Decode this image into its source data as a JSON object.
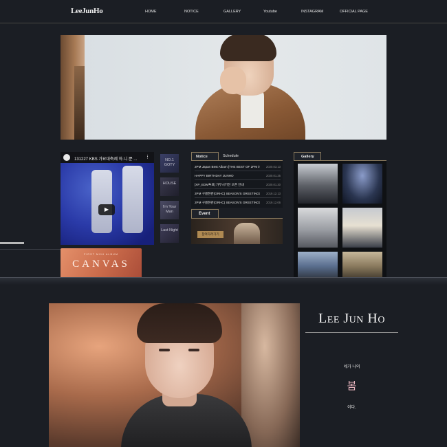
{
  "header": {
    "logo": "LeeJunHo",
    "nav": [
      "HOME",
      "NOTICE",
      "GALLERY",
      "Youtube",
      "INSTAGRAM",
      "OFFICIAL PAGE"
    ]
  },
  "video": {
    "title": "131227 KBS 가요대축제 하.니.뿐 ...",
    "menu_icon": "⋮",
    "play_icon": "▶"
  },
  "albums": [
    "NO.1 GOTY",
    "HOUSE",
    "I'm Your Man",
    "Last Night"
  ],
  "notice": {
    "tabs": [
      "Notice",
      "Schedule"
    ],
    "items": [
      {
        "title": "2PM Japan Best Album [THE BEST OF 2PM in Jap...",
        "date": "2020.03.13"
      },
      {
        "title": "HAPPY BIRTHDAY JUNHO",
        "date": "2020.01.25"
      },
      {
        "title": "[XP_EDM투표] 가부시키진 오픈 안내",
        "date": "2020.01.20"
      },
      {
        "title": "2PM 구름현관(GRHC) SEASON'S GREETINGS 20...",
        "date": "2019.12.13"
      },
      {
        "title": "2PM 구름현관(GRHC) SEASON'S GREETINGS 2020...",
        "date": "2019.12.06"
      }
    ]
  },
  "event": {
    "label": "Event",
    "button": "참여하러가기"
  },
  "gallery": {
    "label": "Gallery"
  },
  "banner": {
    "subtitle": "FIRST MINI ALBUM",
    "title": "CANVAS"
  },
  "bio": {
    "name": "Lee Jun Ho",
    "line1": "네가 나의",
    "line2": "봄",
    "line3": "이다."
  }
}
